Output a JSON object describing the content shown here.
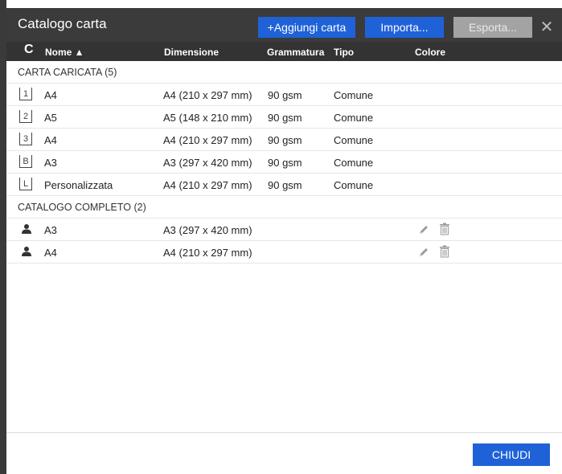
{
  "window": {
    "title": "Catalogo carta"
  },
  "toolbar": {
    "add_label": "+Aggiungi carta",
    "import_label": "Importa...",
    "export_label": "Esporta...",
    "close_glyph": "✕"
  },
  "columns": {
    "refresh_glyph": "C",
    "name": "Nome ▲",
    "dimension": "Dimensione",
    "weight": "Grammatura",
    "type": "Tipo",
    "color": "Colore"
  },
  "loaded": {
    "header": "CARTA CARICATA (5)",
    "rows": [
      {
        "tray": "1",
        "name": "A4",
        "dimension": "A4 (210 x 297 mm)",
        "weight": "90 gsm",
        "type": "Comune"
      },
      {
        "tray": "2",
        "name": "A5",
        "dimension": "A5 (148 x 210 mm)",
        "weight": "90 gsm",
        "type": "Comune"
      },
      {
        "tray": "3",
        "name": "A4",
        "dimension": "A4 (210 x 297 mm)",
        "weight": "90 gsm",
        "type": "Comune"
      },
      {
        "tray": "B",
        "name": "A3",
        "dimension": "A3 (297 x 420 mm)",
        "weight": "90 gsm",
        "type": "Comune"
      },
      {
        "tray": "L",
        "name": "Personalizzata",
        "dimension": "A4 (210 x 297 mm)",
        "weight": "90 gsm",
        "type": "Comune"
      }
    ]
  },
  "catalog": {
    "header": "CATALOGO COMPLETO (2)",
    "rows": [
      {
        "name": "A3",
        "dimension": "A3 (297 x 420 mm)"
      },
      {
        "name": "A4",
        "dimension": "A4 (210 x 297 mm)"
      }
    ]
  },
  "footer": {
    "close_label": "CHIUDI"
  },
  "colors": {
    "accent": "#1f62d8",
    "titlebar": "#3b3b3b",
    "header": "#333333",
    "disabled": "#a3a3a3"
  }
}
